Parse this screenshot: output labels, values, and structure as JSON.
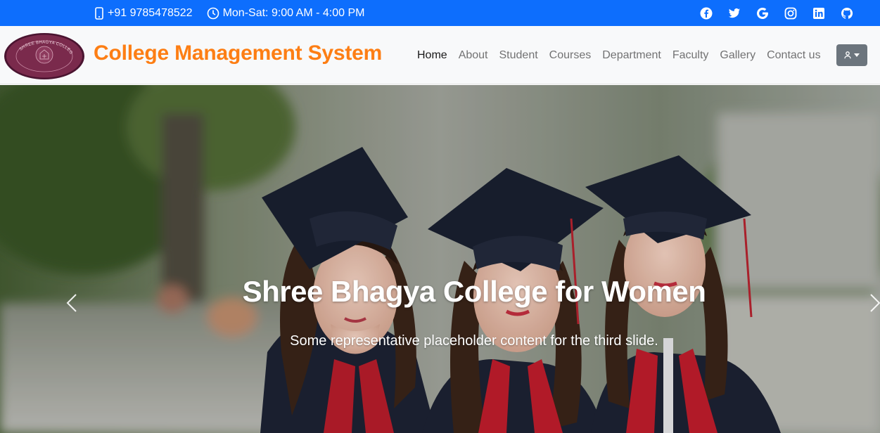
{
  "topbar": {
    "phone": "+91 9785478522",
    "hours": "Mon-Sat: 9:00 AM - 4:00 PM",
    "social": [
      "facebook-icon",
      "twitter-icon",
      "google-icon",
      "instagram-icon",
      "linkedin-icon",
      "github-icon"
    ],
    "color": "#0d6efd"
  },
  "navbar": {
    "brand": "College Management System",
    "brand_color": "#fd7e14",
    "logo_text": "SHREE BHAGYA COLLEGE FOR WOMEN",
    "links": [
      "Home",
      "About",
      "Student",
      "Courses",
      "Department",
      "Faculty",
      "Gallery",
      "Contact us"
    ],
    "active": "Home",
    "user_menu_icon": "person-icon"
  },
  "hero": {
    "title": "Shree Bhagya College for Women",
    "caption": "Some representative placeholder content for the third slide.",
    "prev_icon": "chevron-left-icon",
    "next_icon": "chevron-right-icon"
  }
}
